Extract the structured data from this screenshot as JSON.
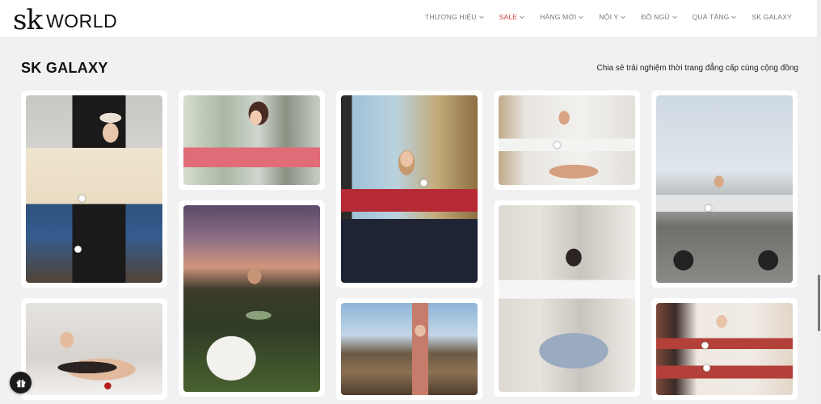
{
  "brand": {
    "logo_mark": "sk",
    "logo_word": "WORLD"
  },
  "nav": {
    "items": [
      {
        "label": "THƯƠNG HIỆU",
        "dropdown": true,
        "active": false
      },
      {
        "label": "SALE",
        "dropdown": true,
        "active": true
      },
      {
        "label": "HÀNG MỚI",
        "dropdown": true,
        "active": false
      },
      {
        "label": "NỘI Y",
        "dropdown": true,
        "active": false
      },
      {
        "label": "ĐỒ NGỦ",
        "dropdown": true,
        "active": false
      },
      {
        "label": "QUÀ TẶNG",
        "dropdown": true,
        "active": false
      },
      {
        "label": "SK GALAXY",
        "dropdown": false,
        "active": false
      }
    ]
  },
  "section": {
    "title": "SK GALAXY",
    "subtitle": "Chia sẻ trải nghiệm thời trang đẳng cấp cùng cộng đồng"
  },
  "gallery": [
    "woman in cap and beige blazer in living room",
    "woman in pink sports bra at gym",
    "woman in red sports bra by window",
    "woman in white bra and shorts on bed",
    "woman with bicycle on bridge at sunset city",
    "woman in black lingerie lying on bed",
    "woman in sage bra at sunset on grass",
    "woman stretching on mountain top",
    "woman taking mirror selfie in white bra",
    "woman in red set with blanket"
  ],
  "colors": {
    "accent": "#d33b3b",
    "background": "#f1f1f1",
    "card": "#ffffff"
  },
  "icons": {
    "chevron": "chevron-down-icon",
    "gift": "gift-icon"
  }
}
